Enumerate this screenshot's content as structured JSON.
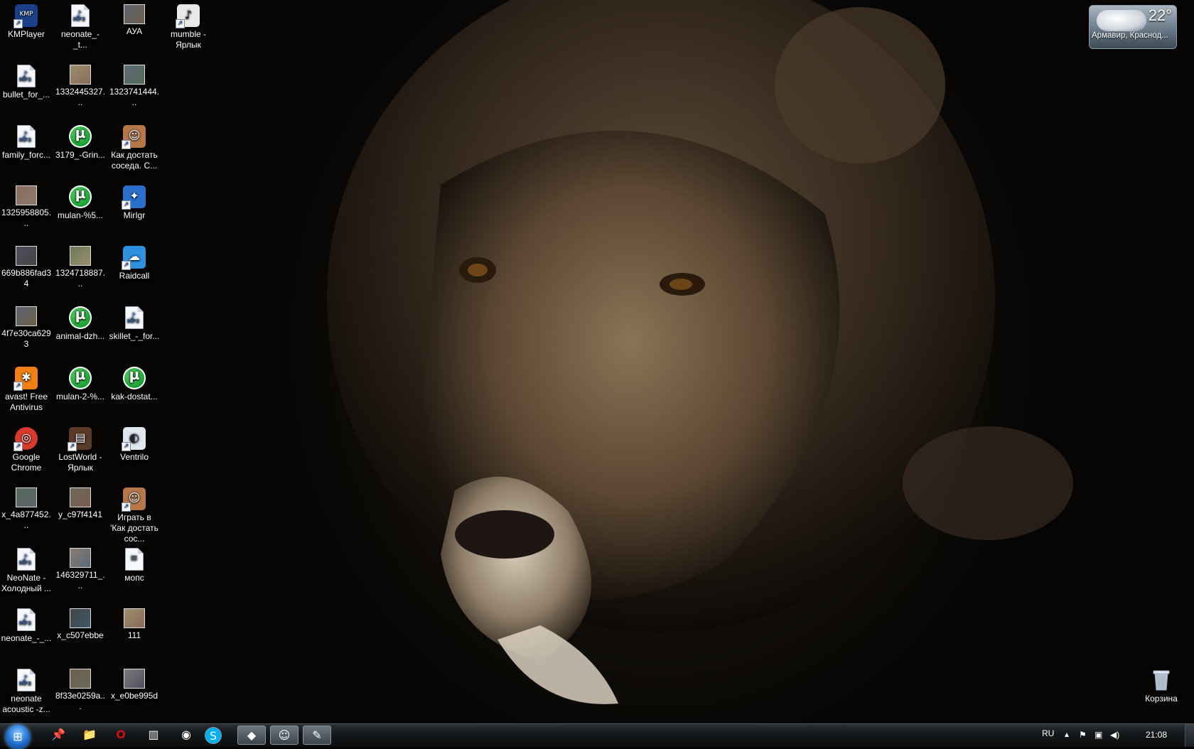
{
  "desktop": {
    "wallpaper": "lioness-dark",
    "icons": [
      {
        "label": "KMPlayer",
        "icon": "kmplayer-icon",
        "type": "shortcut"
      },
      {
        "label": "neonate_-_t...",
        "icon": "mp3-file-icon",
        "type": "mp3"
      },
      {
        "label": "АУА",
        "icon": "image-thumbnail-icon",
        "type": "image"
      },
      {
        "label": "mumble - Ярлык",
        "icon": "mumble-icon",
        "type": "shortcut"
      },
      {
        "label": "bullet_for_...",
        "icon": "mp3-file-icon",
        "type": "mp3"
      },
      {
        "label": "1332445327...",
        "icon": "image-thumbnail-icon",
        "type": "image"
      },
      {
        "label": "1323741444...",
        "icon": "image-thumbnail-icon",
        "type": "image"
      },
      {
        "label": "family_forc...",
        "icon": "mp3-file-icon",
        "type": "mp3"
      },
      {
        "label": "3179_-Grin...",
        "icon": "utorrent-icon",
        "type": "torrent"
      },
      {
        "label": "Как достать соседа. С...",
        "icon": "neighbor-game-icon",
        "type": "shortcut"
      },
      {
        "label": "1325958805...",
        "icon": "image-thumbnail-icon",
        "type": "image"
      },
      {
        "label": "mulan-%5...",
        "icon": "utorrent-icon",
        "type": "torrent"
      },
      {
        "label": "MirIgr",
        "icon": "mirigr-icon",
        "type": "shortcut"
      },
      {
        "label": "669b886fad34",
        "icon": "image-thumbnail-icon",
        "type": "image"
      },
      {
        "label": "1324718887...",
        "icon": "image-thumbnail-icon",
        "type": "image"
      },
      {
        "label": "Raidcall",
        "icon": "raidcall-icon",
        "type": "shortcut"
      },
      {
        "label": "4f7e30ca6293",
        "icon": "image-thumbnail-icon",
        "type": "image"
      },
      {
        "label": "animal-dzh...",
        "icon": "utorrent-icon",
        "type": "torrent"
      },
      {
        "label": "skillet_-_for...",
        "icon": "mp3-file-icon",
        "type": "mp3"
      },
      {
        "label": "avast! Free Antivirus",
        "icon": "avast-icon",
        "type": "shortcut"
      },
      {
        "label": "mulan-2-%...",
        "icon": "utorrent-icon",
        "type": "torrent"
      },
      {
        "label": "kak-dostat...",
        "icon": "utorrent-icon",
        "type": "torrent"
      },
      {
        "label": "Google Chrome",
        "icon": "chrome-icon",
        "type": "shortcut"
      },
      {
        "label": "LostWorld - Ярлык",
        "icon": "lostworld-icon",
        "type": "shortcut"
      },
      {
        "label": "Ventrilo",
        "icon": "ventrilo-icon",
        "type": "shortcut"
      },
      {
        "label": "x_4a877452...",
        "icon": "image-thumbnail-icon",
        "type": "image"
      },
      {
        "label": "y_c97f4141",
        "icon": "image-thumbnail-icon",
        "type": "image"
      },
      {
        "label": "Играть в 'Как достать сос...",
        "icon": "neighbor-game-icon",
        "type": "shortcut"
      },
      {
        "label": "NeoNate - Холодный ...",
        "icon": "mp3-file-icon",
        "type": "mp3"
      },
      {
        "label": "146329711_...",
        "icon": "image-thumbnail-icon",
        "type": "image"
      },
      {
        "label": "мопс",
        "icon": "document-icon",
        "type": "document"
      },
      {
        "label": "neonate_-_...",
        "icon": "mp3-file-icon",
        "type": "mp3"
      },
      {
        "label": "x_c507ebbe",
        "icon": "image-thumbnail-icon",
        "type": "image"
      },
      {
        "label": "111",
        "icon": "image-thumbnail-icon",
        "type": "image"
      },
      {
        "label": "neonate acoustic -z...",
        "icon": "mp3-file-icon",
        "type": "mp3"
      },
      {
        "label": "8f33e0259a...",
        "icon": "image-thumbnail-icon",
        "type": "image"
      },
      {
        "label": "x_e0be995d",
        "icon": "image-thumbnail-icon",
        "type": "image"
      }
    ],
    "recycle_bin": {
      "label": "Корзина",
      "icon": "recycle-bin-icon"
    }
  },
  "weather_gadget": {
    "temperature": "22°",
    "city": "Армавир, Краснод...",
    "icon": "cloud-icon"
  },
  "taskbar": {
    "start_icon": "windows-start-orb-icon",
    "pinned": [
      {
        "name": "pin-icon",
        "glyph": "📌"
      },
      {
        "name": "folder-icon",
        "glyph": "📁"
      },
      {
        "name": "opera-icon",
        "glyph": "O"
      },
      {
        "name": "book-icon",
        "glyph": "▥"
      },
      {
        "name": "network-icon",
        "glyph": "◉"
      },
      {
        "name": "skype-icon",
        "glyph": "S"
      },
      {
        "name": "wolf-icon",
        "glyph": "◆"
      },
      {
        "name": "game-character-icon",
        "glyph": "☺"
      },
      {
        "name": "paint-icon",
        "glyph": "✎"
      }
    ],
    "tray": {
      "language": "RU",
      "clock": "21:08",
      "icons": [
        "show-hidden-icons-icon",
        "action-center-flag-icon",
        "network-icon",
        "volume-icon"
      ]
    },
    "colors": {
      "opera": "#cc1111",
      "skype": "#00aff0"
    }
  }
}
